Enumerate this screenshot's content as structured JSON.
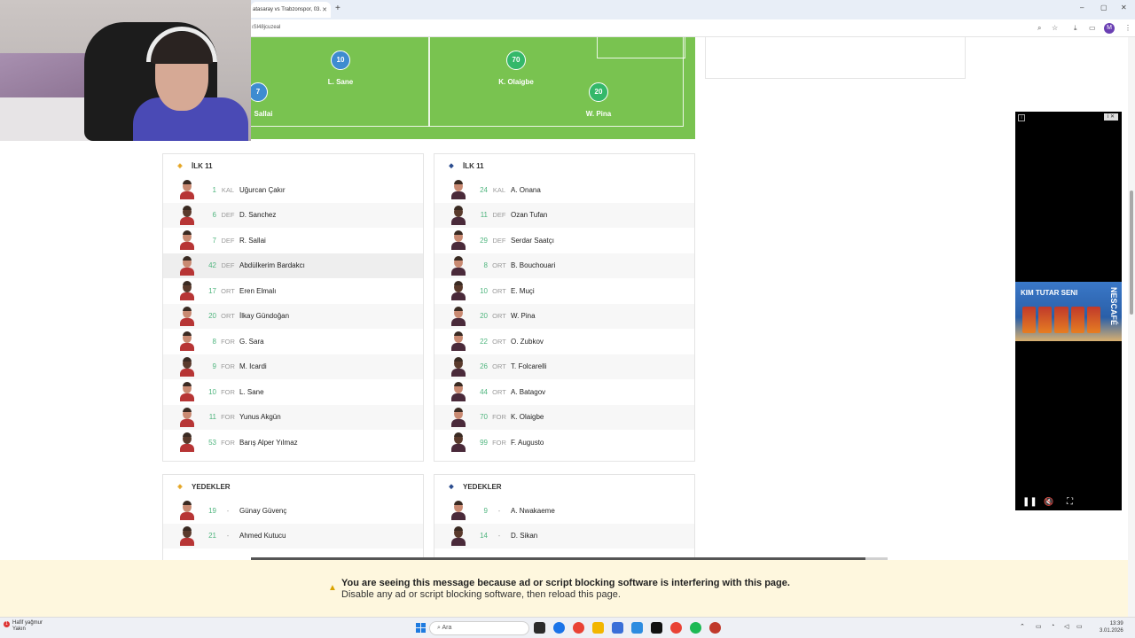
{
  "browser": {
    "tab_title": "atasaray vs Trabzonspor, 03.",
    "tab_close": "✕",
    "new_tab": "+",
    "url": "ıSl48jcuzeal",
    "win_minimize": "–",
    "win_restore": "▢",
    "win_close": "✕",
    "profile_letter": "M"
  },
  "pitch": {
    "players": [
      {
        "number": "10",
        "name": "L. Sane",
        "color": "blue"
      },
      {
        "number": "7",
        "name": "Sallai",
        "color": "blue"
      },
      {
        "number": "70",
        "name": "K. Olaigbe",
        "color": "green"
      },
      {
        "number": "20",
        "name": "W. Pina",
        "color": "green"
      }
    ]
  },
  "home_lineup": {
    "title": "İLK 11",
    "players": [
      {
        "number": "1",
        "pos": "KAL",
        "name": "Uğurcan Çakır"
      },
      {
        "number": "6",
        "pos": "DEF",
        "name": "D. Sanchez"
      },
      {
        "number": "7",
        "pos": "DEF",
        "name": "R. Sallai"
      },
      {
        "number": "42",
        "pos": "DEF",
        "name": "Abdülkerim Bardakcı"
      },
      {
        "number": "17",
        "pos": "ORT",
        "name": "Eren Elmalı"
      },
      {
        "number": "20",
        "pos": "ORT",
        "name": "İlkay Gündoğan"
      },
      {
        "number": "8",
        "pos": "FOR",
        "name": "G. Sara"
      },
      {
        "number": "9",
        "pos": "FOR",
        "name": "M. Icardi"
      },
      {
        "number": "10",
        "pos": "FOR",
        "name": "L. Sane"
      },
      {
        "number": "11",
        "pos": "FOR",
        "name": "Yunus Akgün"
      },
      {
        "number": "53",
        "pos": "FOR",
        "name": "Barış Alper Yılmaz"
      }
    ]
  },
  "away_lineup": {
    "title": "İLK 11",
    "players": [
      {
        "number": "24",
        "pos": "KAL",
        "name": "A. Onana"
      },
      {
        "number": "11",
        "pos": "DEF",
        "name": "Ozan Tufan"
      },
      {
        "number": "29",
        "pos": "DEF",
        "name": "Serdar Saatçı"
      },
      {
        "number": "8",
        "pos": "ORT",
        "name": "B. Bouchouari"
      },
      {
        "number": "10",
        "pos": "ORT",
        "name": "E. Muçi"
      },
      {
        "number": "20",
        "pos": "ORT",
        "name": "W. Pina"
      },
      {
        "number": "22",
        "pos": "ORT",
        "name": "O. Zubkov"
      },
      {
        "number": "26",
        "pos": "ORT",
        "name": "T. Folcarelli"
      },
      {
        "number": "44",
        "pos": "ORT",
        "name": "A. Batagov"
      },
      {
        "number": "70",
        "pos": "FOR",
        "name": "K. Olaigbe"
      },
      {
        "number": "99",
        "pos": "FOR",
        "name": "F. Augusto"
      }
    ]
  },
  "home_subs": {
    "title": "YEDEKLER",
    "players": [
      {
        "number": "19",
        "pos": "-",
        "name": "Günay Güvenç"
      },
      {
        "number": "21",
        "pos": "-",
        "name": "Ahmed Kutucu"
      }
    ]
  },
  "away_subs": {
    "title": "YEDEKLER",
    "players": [
      {
        "number": "9",
        "pos": "-",
        "name": "A. Nwakaeme"
      },
      {
        "number": "14",
        "pos": "-",
        "name": "D. Sikan"
      }
    ]
  },
  "ad": {
    "headline": "KIM TUTAR SENI",
    "brand": "NESCAFÉ",
    "pause": "❚❚",
    "mute": "🔇",
    "fullscreen": "⛶",
    "info": "i ✕"
  },
  "notice": {
    "line1": "You are seeing this message because ad or script blocking software is interfering with this page.",
    "line2": "Disable any ad or script blocking software, then reload this page."
  },
  "taskbar": {
    "weather_line1": "Hafif yağmur",
    "weather_line2": "Yakın",
    "search_placeholder": "Ara",
    "time": "13:39",
    "date": "3.01.2026"
  },
  "colors": {
    "pitch": "#79c350",
    "home_dot": "#3e8cd0",
    "away_dot": "#34b86a",
    "number_green": "#4fb57e",
    "notice_bg": "#fef7de"
  }
}
